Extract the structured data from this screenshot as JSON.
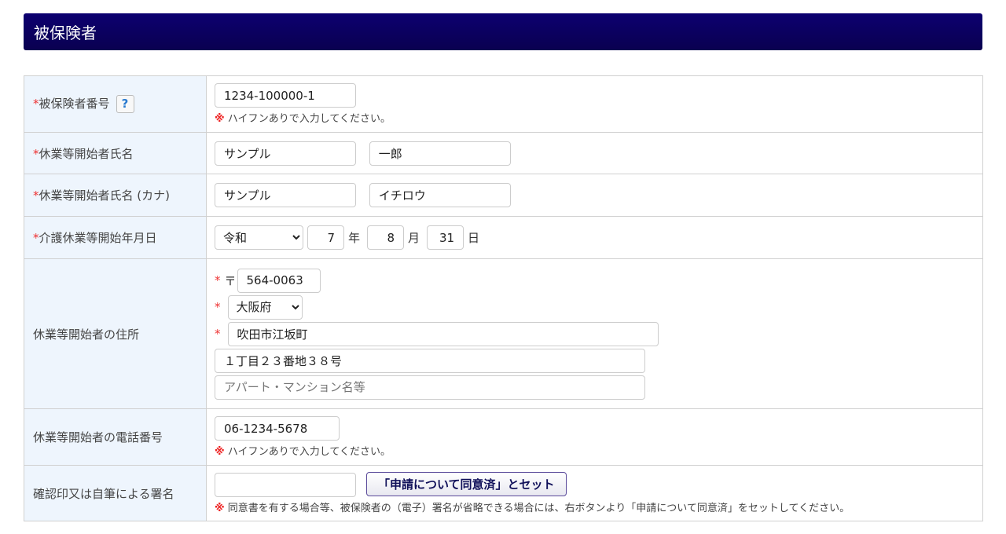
{
  "section_title": "被保険者",
  "required_mark": "*",
  "note_mark": "※",
  "help_label": "?",
  "rows": {
    "insured_number": {
      "label": "被保険者番号",
      "value": "1234-100000-1",
      "note": "ハイフンありで入力してください。"
    },
    "name": {
      "label": "休業等開始者氏名",
      "last": "サンプル",
      "first": "一郎"
    },
    "kana": {
      "label": "休業等開始者氏名 (カナ)",
      "last": "サンプル",
      "first": "イチロウ"
    },
    "start_date": {
      "label": "介護休業等開始年月日",
      "era": "令和",
      "year": "7",
      "year_unit": "年",
      "month": "8",
      "month_unit": "月",
      "day": "31",
      "day_unit": "日"
    },
    "address": {
      "label": "休業等開始者の住所",
      "postal_mark": "〒",
      "postal": "564-0063",
      "prefecture": "大阪府",
      "city": "吹田市江坂町",
      "street": "１丁目２３番地３８号",
      "building_placeholder": "アパート・マンション名等"
    },
    "phone": {
      "label": "休業等開始者の電話番号",
      "value": "06-1234-5678",
      "note": "ハイフンありで入力してください。"
    },
    "signature": {
      "label": "確認印又は自筆による署名",
      "value": "",
      "button": "「申請について同意済」とセット",
      "note": "同意書を有する場合等、被保険者の（電子）署名が省略できる場合には、右ボタンより「申請について同意済」をセットしてください。"
    }
  }
}
